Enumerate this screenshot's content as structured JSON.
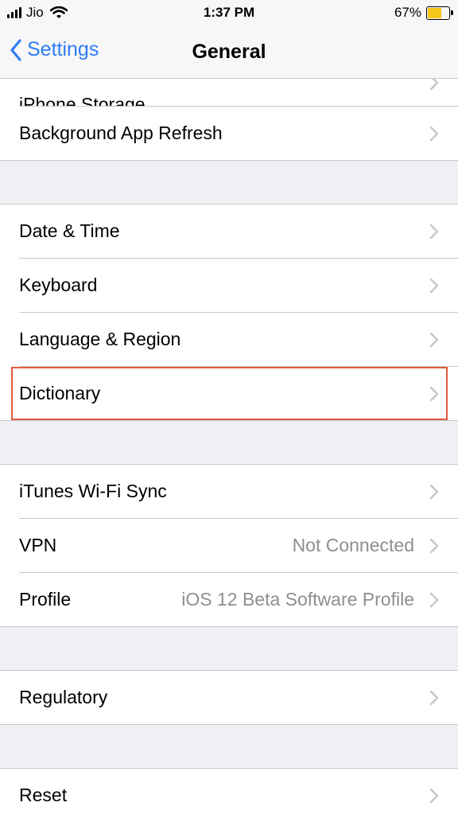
{
  "status": {
    "carrier": "Jio",
    "time": "1:37 PM",
    "battery": "67%",
    "battery_level": 0.67
  },
  "nav": {
    "back_label": "Settings",
    "title": "General"
  },
  "rows": {
    "iphone_storage": "iPhone Storage",
    "background_refresh": "Background App Refresh",
    "date_time": "Date & Time",
    "keyboard": "Keyboard",
    "language_region": "Language & Region",
    "dictionary": "Dictionary",
    "itunes_sync": "iTunes Wi-Fi Sync",
    "vpn": "VPN",
    "vpn_value": "Not Connected",
    "profile": "Profile",
    "profile_value": "iOS 12 Beta Software Profile",
    "regulatory": "Regulatory",
    "reset": "Reset"
  },
  "colors": {
    "accent": "#2f7cf6",
    "highlight": "#e35a3d",
    "battery": "#f5c518"
  }
}
